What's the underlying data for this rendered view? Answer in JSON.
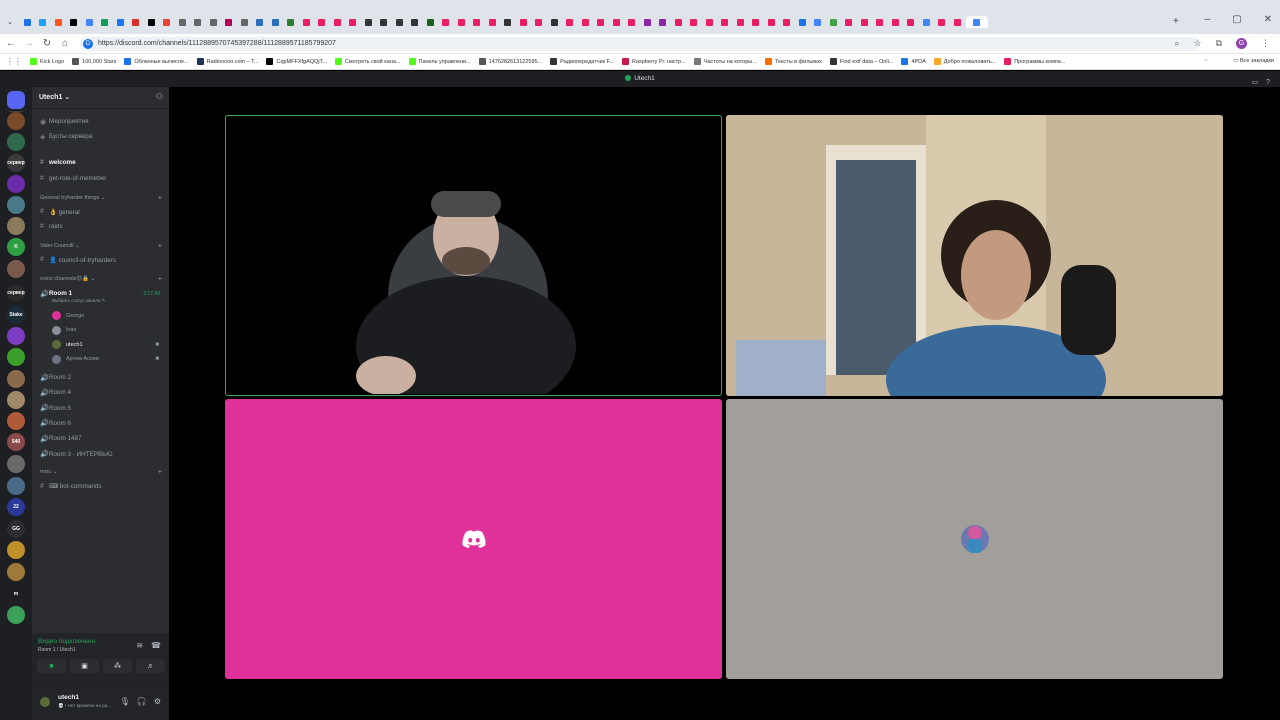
{
  "browser": {
    "tab_colors": [
      "#1a73e8",
      "#1da1f2",
      "#ff5722",
      "#000000",
      "#4285f4",
      "#0f9d58",
      "#1877f2",
      "#d93025",
      "#000000",
      "#ea4335",
      "#666666",
      "#666666",
      "#666666",
      "#b30059",
      "#666666",
      "#2a6ebb",
      "#2a6ebb",
      "#2e7d32",
      "#e91e63",
      "#e91e63",
      "#e91e63",
      "#e91e63",
      "#333333",
      "#333333",
      "#333333",
      "#333333",
      "#1b5e20",
      "#e91e63",
      "#e91e63",
      "#e91e63",
      "#e91e63",
      "#333333",
      "#e91e63",
      "#e91e63",
      "#333333",
      "#e91e63",
      "#e91e63",
      "#e91e63",
      "#e91e63",
      "#e91e63",
      "#8e24aa",
      "#8e24aa",
      "#e91e63",
      "#e91e63",
      "#e91e63",
      "#e91e63",
      "#e91e63",
      "#e91e63",
      "#e91e63",
      "#e91e63",
      "#1a73e8",
      "#4285f4",
      "#43a047",
      "#e91e63",
      "#e91e63",
      "#e91e63",
      "#e91e63",
      "#e91e63",
      "#4285f4",
      "#e91e63",
      "#e91e63",
      "#4285f4"
    ],
    "url": "https://discord.com/channels/1112889570745397288/1112889571185799207",
    "profile_initial": "G",
    "bookmarks": [
      {
        "label": "Kick Logo",
        "color": "#53fc18"
      },
      {
        "label": "100,000 Stars",
        "color": "#555555"
      },
      {
        "label": "Облачные вычисле...",
        "color": "#1a73e8"
      },
      {
        "label": "Radiooooo.com – T...",
        "color": "#1d3557"
      },
      {
        "label": "CqpMFFXfgAQQjT...",
        "color": "#000000"
      },
      {
        "label": "Смотреть свой кана...",
        "color": "#53fc18"
      },
      {
        "label": "Панель управлени...",
        "color": "#53fc18"
      },
      {
        "label": "1476282613122595...",
        "color": "#555555"
      },
      {
        "label": "Радиопередатчик F...",
        "color": "#333333"
      },
      {
        "label": "Raspberry Pi: настр...",
        "color": "#c51a4a"
      },
      {
        "label": "Частоты на которы...",
        "color": "#777777"
      },
      {
        "label": "Тексты в фильмах",
        "color": "#ff6d00"
      },
      {
        "label": "Find exif data – Onli...",
        "color": "#333333"
      },
      {
        "label": "4PDA",
        "color": "#1a73e8"
      },
      {
        "label": "Добро пожаловать...",
        "color": "#f9a825"
      },
      {
        "label": "Программы компа...",
        "color": "#e91e63"
      }
    ],
    "all_bookmarks": "Все закладки"
  },
  "discord": {
    "window_title": "Utech1",
    "server_name": "Utech1",
    "channels": [
      {
        "icon": "◉",
        "label": "Мероприятия",
        "active": false
      },
      {
        "icon": "◈",
        "label": "Бусты сервера",
        "active": false
      },
      {
        "icon": "#",
        "label": "welcome",
        "active": true
      },
      {
        "icon": "#",
        "label": "get-role-of-memeber",
        "active": false
      }
    ],
    "categories": {
      "tryharder": "General tryharder things",
      "valor": "Valer Councill",
      "voice": "voice channels😊🔒",
      "misc": "misc"
    },
    "text_channels": {
      "general": "👌 general",
      "raids": "raids",
      "council": "👤 council-of-tryharders",
      "bot": "⌨ bot-commands"
    },
    "voice_room": {
      "name": "Room 1",
      "timer": "2:17:49",
      "status": "Выбрать статус канала ✎"
    },
    "members": [
      {
        "name": "George",
        "color": "#e0319a",
        "camera": false
      },
      {
        "name": "Ivan",
        "color": "#8a8f98",
        "camera": false
      },
      {
        "name": "utech1",
        "color": "#5a6b3a",
        "camera": true
      },
      {
        "name": "Артем Асеев",
        "color": "#6b7280",
        "camera": true
      }
    ],
    "voice_rooms": [
      "Room 2",
      "Room 4",
      "Room 5",
      "Room 6",
      "Room 1487",
      "Room 3 - ИНТЕРВЬЮ"
    ],
    "voice_status": {
      "connected": "Видео подключено",
      "location": "Room 1 / Utech1"
    },
    "user": {
      "name": "utech1",
      "status": "💀 • Нет времени на ра..."
    },
    "guild_icons": [
      {
        "label": "",
        "color": "#5865f2"
      },
      {
        "label": "",
        "color": "#7a4a2a"
      },
      {
        "label": "",
        "color": "#2f6b4a"
      },
      {
        "label": "сервер",
        "color": "#3a3a3a"
      },
      {
        "label": "",
        "color": "#6a2ba8"
      },
      {
        "label": "",
        "color": "#4a7a8a"
      },
      {
        "label": "",
        "color": "#8a7a5a"
      },
      {
        "label": "K",
        "color": "#2ea043"
      },
      {
        "label": "",
        "color": "#7a5a4a"
      },
      {
        "label": "сервер",
        "color": "#2a2a2a"
      },
      {
        "label": "Stake",
        "color": "#1a2c38"
      },
      {
        "label": "",
        "color": "#7d3cc2"
      },
      {
        "label": "",
        "color": "#3aa02a"
      },
      {
        "label": "",
        "color": "#8a6a4a"
      },
      {
        "label": "",
        "color": "#a08a6a"
      },
      {
        "label": "",
        "color": "#b05a3a"
      },
      {
        "label": "540",
        "color": "#8a4a4a"
      },
      {
        "label": "",
        "color": "#6a6a6a"
      },
      {
        "label": "",
        "color": "#4a6a8a"
      },
      {
        "label": "22",
        "color": "#2a3a9a"
      },
      {
        "label": "GG",
        "color": "#2b2d31"
      },
      {
        "label": "",
        "color": "#c0902a"
      },
      {
        "label": "",
        "color": "#a07a3a"
      },
      {
        "label": "m",
        "color": "#1e1f22"
      },
      {
        "label": "",
        "color": "#3aa05a"
      }
    ]
  },
  "tiles": [
    {
      "kind": "camera",
      "color": "#000000"
    },
    {
      "kind": "camera",
      "color": "#c9b79c"
    },
    {
      "kind": "avatar-discord",
      "color": "#e0319a"
    },
    {
      "kind": "avatar-image",
      "color": "#a29e9a"
    }
  ]
}
